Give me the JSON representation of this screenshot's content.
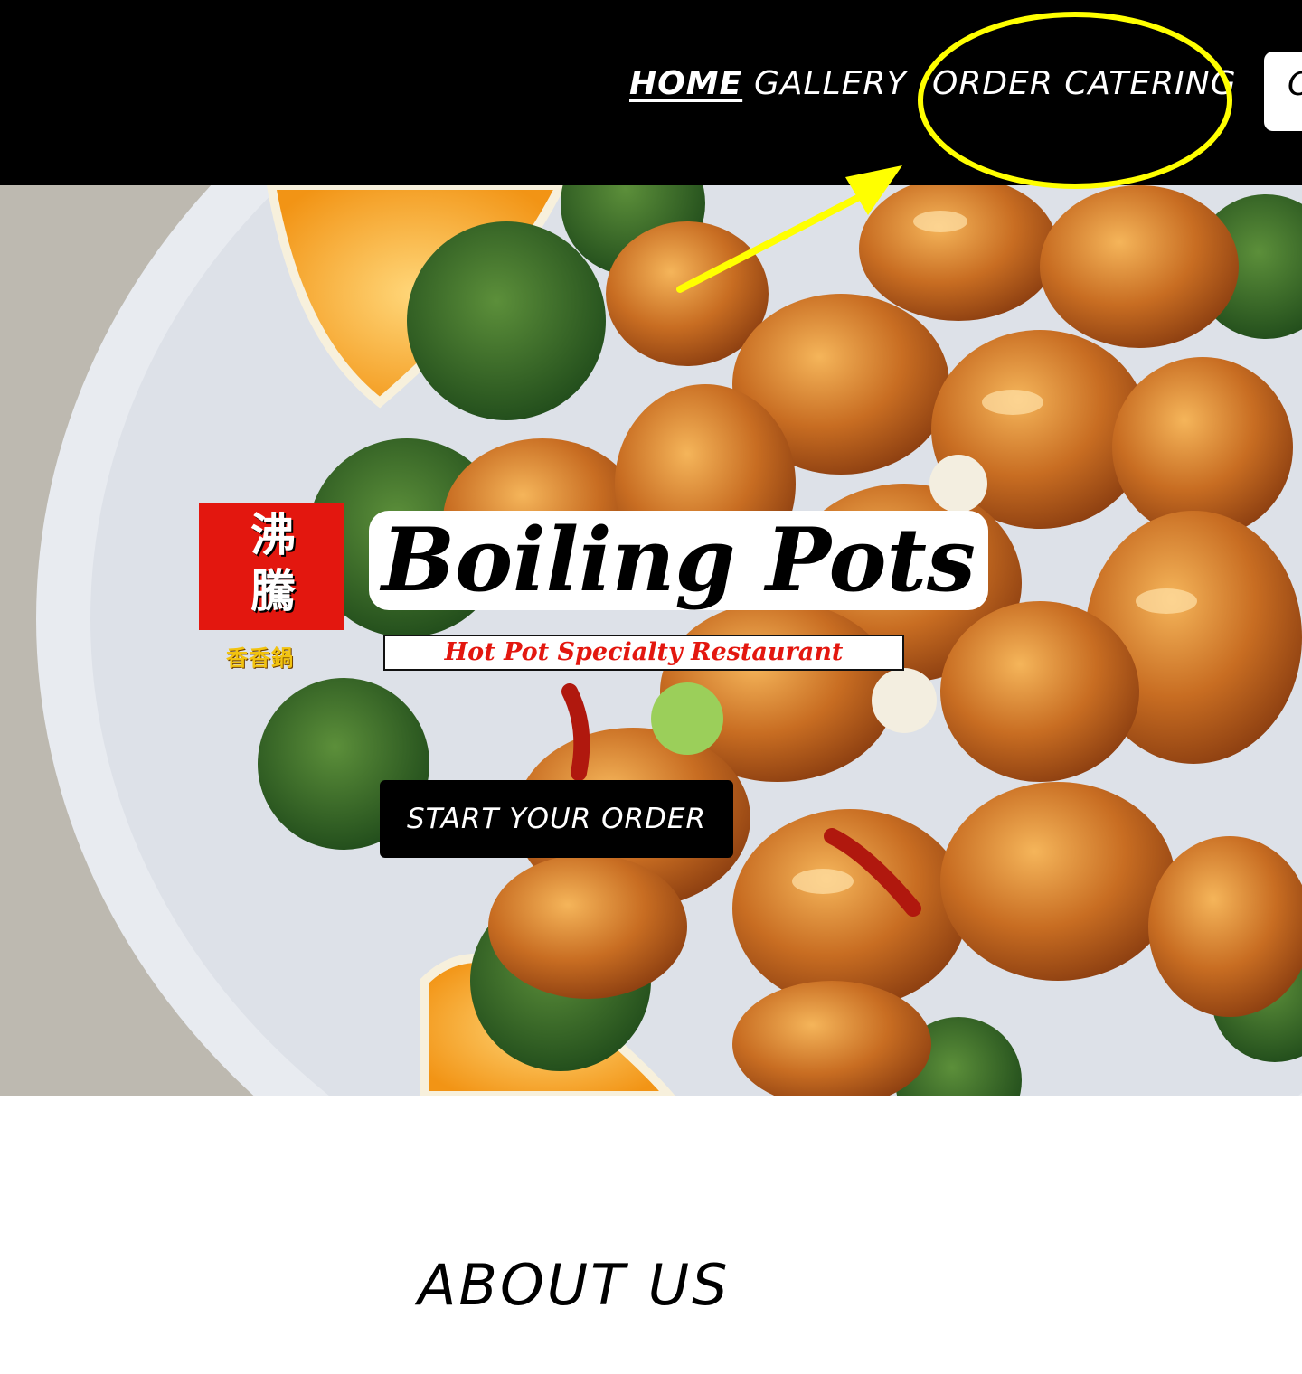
{
  "nav": {
    "home": "HOME",
    "gallery": "GALLERY",
    "order_catering": "ORDER CATERING",
    "cta_partial": "O"
  },
  "hero": {
    "brand_cn": "沸騰",
    "brand_cn_sub": "香香鍋",
    "brand_name": "Boiling Pots",
    "brand_tagline": "Hot Pot Specialty Restaurant",
    "start_order": "START YOUR ORDER"
  },
  "about": {
    "title": "ABOUT US"
  },
  "colors": {
    "header_bg": "#000000",
    "annotation": "#ffff00",
    "brand_red": "#e3170f",
    "brand_gold": "#f2c30f"
  },
  "annotation": {
    "shape": "ellipse",
    "marker": "arrow",
    "target": "order_catering"
  }
}
